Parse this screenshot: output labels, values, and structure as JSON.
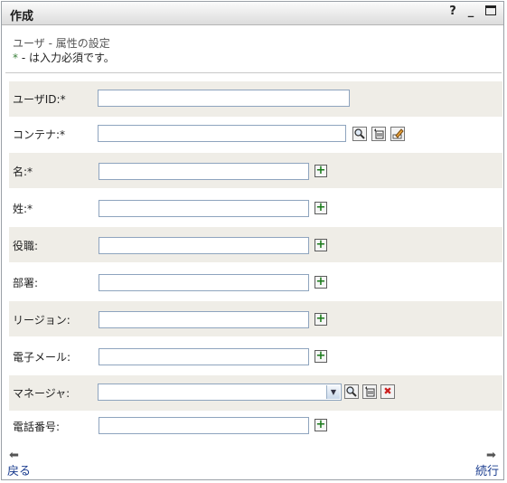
{
  "window": {
    "title": "作成",
    "help_glyph": "?",
    "minimize_glyph": "_",
    "maximize_glyph": "□"
  },
  "header": {
    "subtitle": "ユーザ - 属性の設定",
    "required_star": "*",
    "required_text": " - は入力必須です。"
  },
  "form": {
    "user_id_label": "ユーザID:*",
    "container_label": "コンテナ:*",
    "given_name_label": "名:*",
    "surname_label": "姓:*",
    "title_label": "役職:",
    "department_label": "部署:",
    "region_label": "リージョン:",
    "email_label": "電子メール:",
    "manager_label": "マネージャ:",
    "phone_label": "電話番号:"
  },
  "nav": {
    "back_label": "戻る",
    "next_label": "続行"
  },
  "icons": {
    "plus": "+",
    "delete": "✖",
    "arrow_left": "⬅",
    "arrow_right": "➡",
    "select_arrow": "▼"
  },
  "colors": {
    "row_shade": "#efede7",
    "link": "#1a3c8f",
    "plus_green": "#1a7a1a",
    "delete_red": "#cc1f1f"
  }
}
